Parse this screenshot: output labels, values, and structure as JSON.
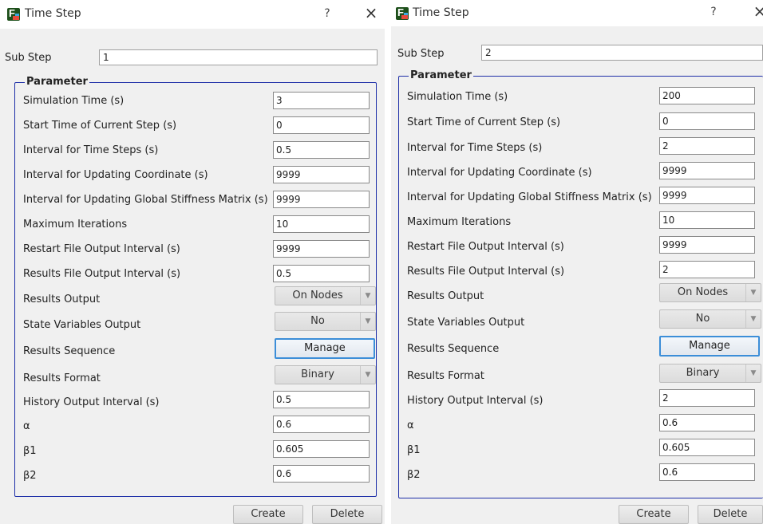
{
  "icon": "fssi-app-icon",
  "dialogs": [
    {
      "title": "Time Step",
      "help_glyph": "?",
      "close_glyph": "×",
      "substep_label": "Sub Step",
      "substep_value": "1",
      "group_title": "Parameter",
      "params": [
        {
          "label": "Simulation Time (s)",
          "value": "3"
        },
        {
          "label": "Start Time of Current Step (s)",
          "value": "0"
        },
        {
          "label": "Interval for Time Steps (s)",
          "value": "0.5"
        },
        {
          "label": "Interval for Updating Coordinate (s)",
          "value": "9999"
        },
        {
          "label": "Interval for Updating Global Stiffness Matrix (s)",
          "value": "9999"
        },
        {
          "label": "Maximum Iterations",
          "value": "10"
        },
        {
          "label": "Restart File Output Interval (s)",
          "value": "9999"
        },
        {
          "label": "Results File Output Interval (s)",
          "value": "0.5"
        },
        {
          "label": "Results Output",
          "value": "On Nodes"
        },
        {
          "label": "State Variables Output",
          "value": "No"
        },
        {
          "label": "Results Sequence",
          "value": "Manage"
        },
        {
          "label": "Results Format",
          "value": "Binary"
        },
        {
          "label": "History Output Interval (s)",
          "value": "0.5"
        },
        {
          "label": "α",
          "value": "0.6"
        },
        {
          "label": "β1",
          "value": "0.605"
        },
        {
          "label": "β2",
          "value": "0.6"
        }
      ],
      "create_label": "Create",
      "delete_label": "Delete"
    },
    {
      "title": "Time Step",
      "help_glyph": "?",
      "close_glyph": "×",
      "substep_label": "Sub Step",
      "substep_value": "2",
      "group_title": "Parameter",
      "params": [
        {
          "label": "Simulation Time (s)",
          "value": "200"
        },
        {
          "label": "Start Time of Current Step (s)",
          "value": "0"
        },
        {
          "label": "Interval for Time Steps (s)",
          "value": "2"
        },
        {
          "label": "Interval for Updating Coordinate (s)",
          "value": "9999"
        },
        {
          "label": "Interval for Updating Global Stiffness Matrix (s)",
          "value": "9999"
        },
        {
          "label": "Maximum Iterations",
          "value": "10"
        },
        {
          "label": "Restart File Output Interval (s)",
          "value": "9999"
        },
        {
          "label": "Results File Output Interval (s)",
          "value": "2"
        },
        {
          "label": "Results Output",
          "value": "On Nodes"
        },
        {
          "label": "State Variables Output",
          "value": "No"
        },
        {
          "label": "Results Sequence",
          "value": "Manage"
        },
        {
          "label": "Results Format",
          "value": "Binary"
        },
        {
          "label": "History Output Interval (s)",
          "value": "2"
        },
        {
          "label": "α",
          "value": "0.6"
        },
        {
          "label": "β1",
          "value": "0.605"
        },
        {
          "label": "β2",
          "value": "0.6"
        }
      ],
      "create_label": "Create",
      "delete_label": "Delete"
    }
  ]
}
